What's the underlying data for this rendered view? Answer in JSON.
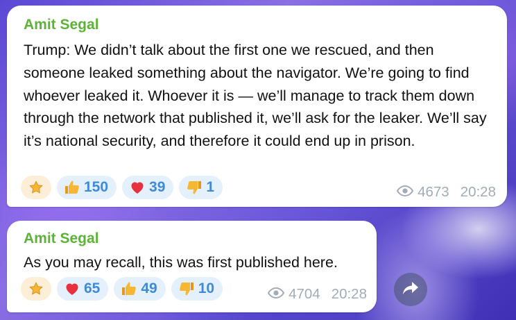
{
  "messages": [
    {
      "sender": "Amit Segal",
      "text": "Trump: We didn’t talk about the first one we rescued, and then someone leaked something about the navigator. We’re going to find whoever leaked it. Whoever it is — we’ll manage to track them down through the network that published it, we’ll ask for the leaker. We’ll say it’s national security, and therefore it could end up in prison.",
      "reactions": [
        {
          "icon": "star-icon",
          "count": ""
        },
        {
          "icon": "thumbs-up-icon",
          "count": "150"
        },
        {
          "icon": "heart-icon",
          "count": "39"
        },
        {
          "icon": "thumbs-down-icon",
          "count": "1"
        }
      ],
      "views": "4673",
      "time": "20:28"
    },
    {
      "sender": "Amit Segal",
      "text": "As you may recall, this was first published here.",
      "reactions": [
        {
          "icon": "star-icon",
          "count": ""
        },
        {
          "icon": "heart-icon",
          "count": "65"
        },
        {
          "icon": "thumbs-up-icon",
          "count": "49"
        },
        {
          "icon": "thumbs-down-icon",
          "count": "10"
        }
      ],
      "views": "4704",
      "time": "20:28"
    }
  ],
  "forward_button": {
    "icon": "forward-arrow-icon"
  },
  "colors": {
    "sender": "#5cb338",
    "reaction_count": "#3f8ad8",
    "reaction_bg": "#e4f0fb",
    "meta": "#a2acb6",
    "heart": "#e8313f",
    "thumb": "#f5a623"
  }
}
